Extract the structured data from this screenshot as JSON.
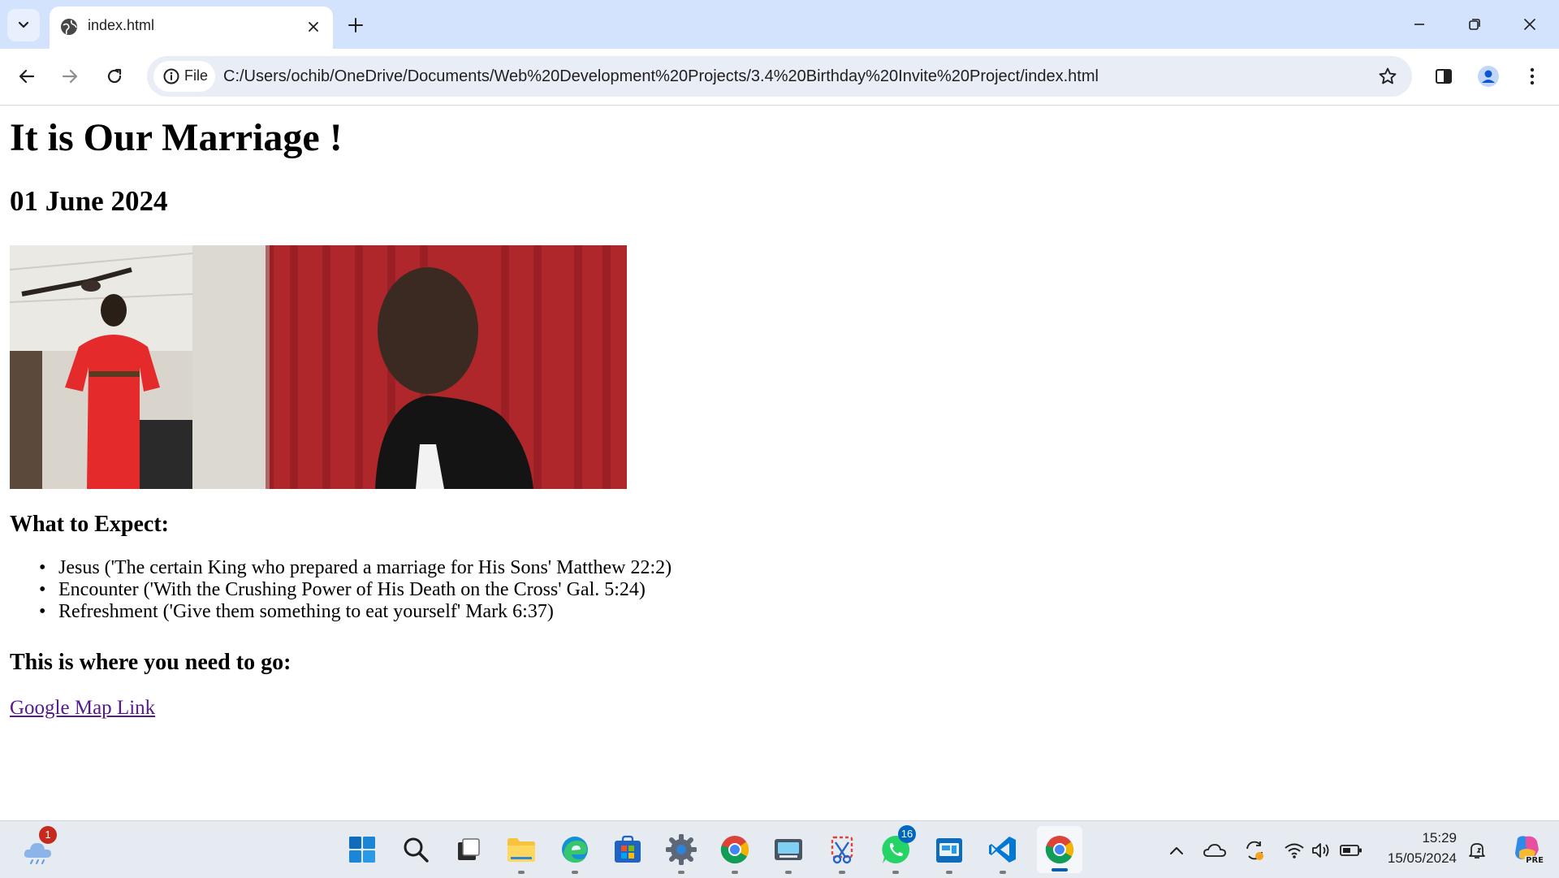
{
  "browser": {
    "tab_title": "index.html",
    "site_chip_label": "File",
    "url": "C:/Users/ochib/OneDrive/Documents/Web%20Development%20Projects/3.4%20Birthday%20Invite%20Project/index.html"
  },
  "page": {
    "title": "It is Our Marriage !",
    "date": "01 June 2024",
    "expect_heading": "What to Expect:",
    "expect_items": [
      "Jesus ('The certain King who prepared a marriage for His Sons' Matthew 22:2)",
      "Encounter ('With the Crushing Power of His Death on the Cross' Gal. 5:24)",
      "Refreshment ('Give them something to eat yourself' Mark 6:37)"
    ],
    "location_heading": "This is where you need to go:",
    "map_link_text": "Google Map Link",
    "link_color": "#551a8b"
  },
  "taskbar": {
    "weather_badge": "1",
    "whatsapp_badge": "16",
    "time": "15:29",
    "date": "15/05/2024",
    "copilot_label": "PRE"
  },
  "colors": {
    "tabstrip_bg": "#d3e3fd",
    "omnibox_bg": "#e9eef6",
    "taskbar_bg": "#e6ebf1",
    "accent": "#005fb8",
    "badge_red": "#c42b1c",
    "badge_blue": "#0067c0"
  }
}
